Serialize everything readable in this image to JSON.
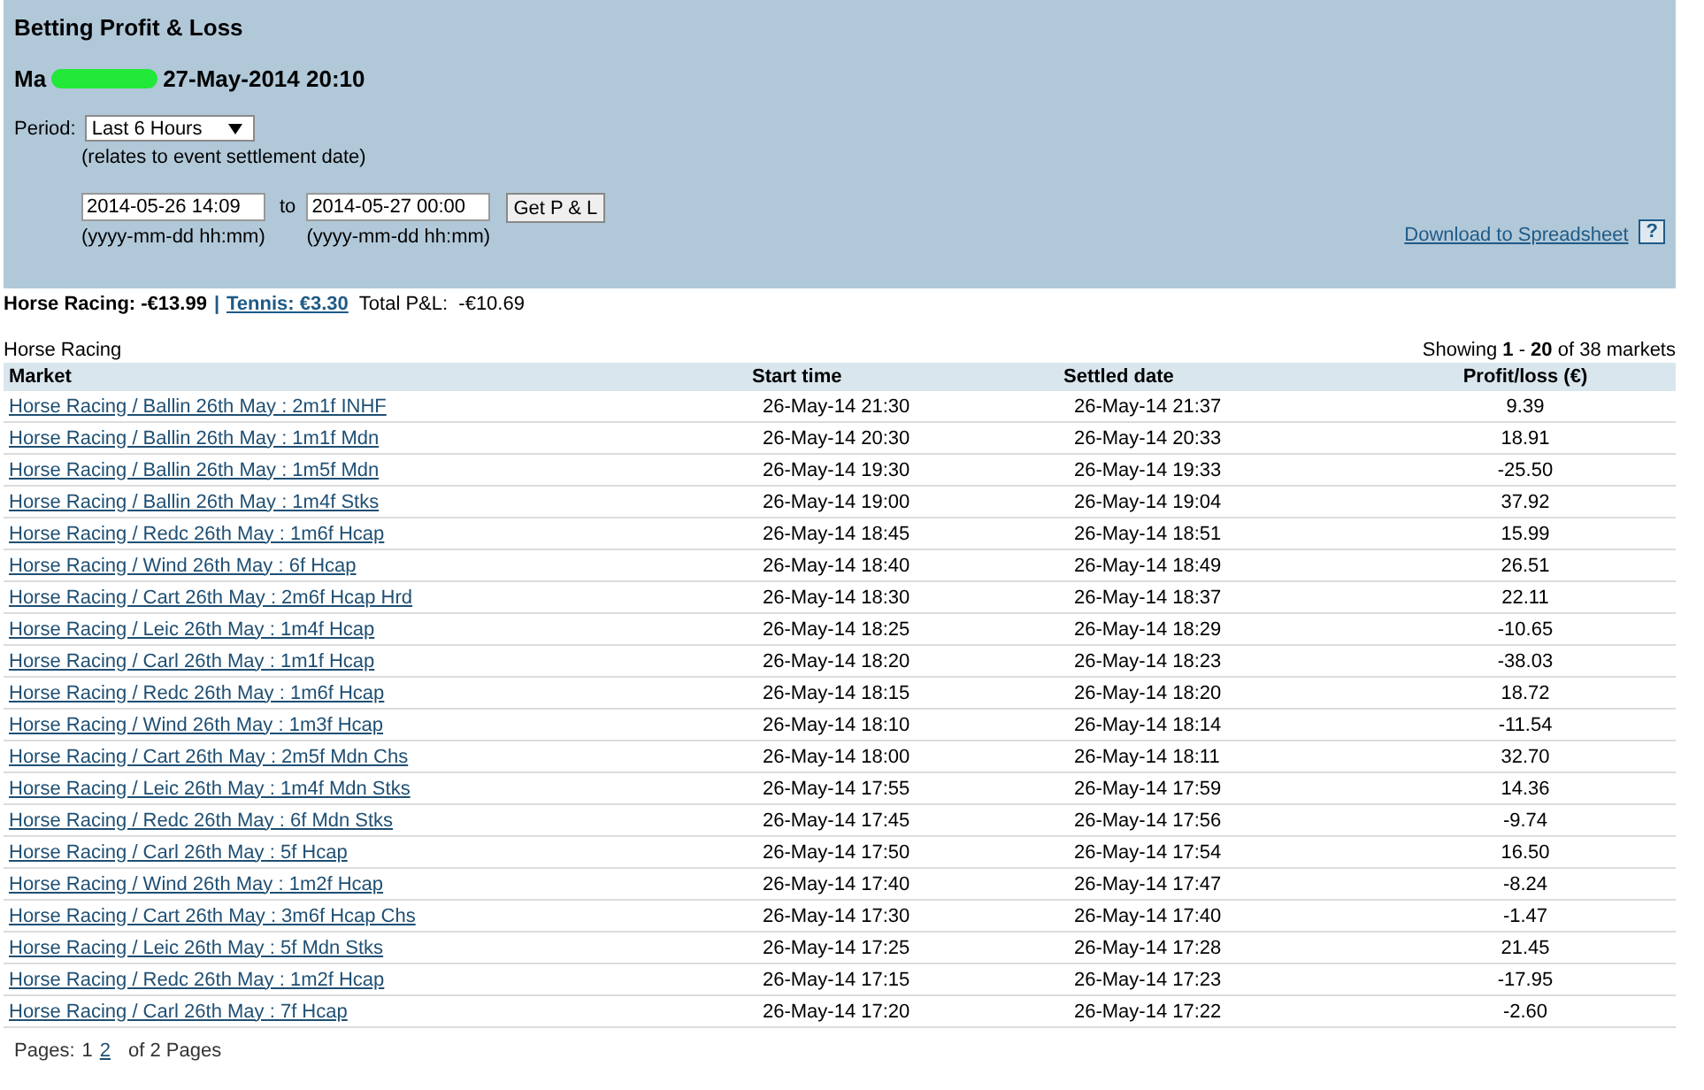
{
  "header": {
    "title": "Betting Profit & Loss",
    "user_prefix": "Ma",
    "redacted": true,
    "timestamp": "27-May-2014 20:10"
  },
  "filter": {
    "period_label": "Period:",
    "period": "Last 6 Hours",
    "period_note": "(relates to event settlement date)",
    "from": "2014-05-26 14:09",
    "to_label": "to",
    "to": "2014-05-27 00:00",
    "from_hint": "(yyyy-mm-dd hh:mm)",
    "to_hint": "(yyyy-mm-dd hh:mm)",
    "button": "Get P & L",
    "download_link": "Download to Spreadsheet",
    "help": "?"
  },
  "summary_separator": "|",
  "summary": [
    {
      "text": "Horse Racing: -€13.99",
      "kind": "current"
    },
    {
      "text": "Tennis: €3.30",
      "kind": "link"
    },
    {
      "text": "Total P&L:  -€10.69",
      "kind": "total"
    }
  ],
  "section": "Horse Racing",
  "showing": "Showing **1** - **20** of 38 markets",
  "table": {
    "columns": [
      "Market",
      "Start time",
      "Settled date",
      "Profit/loss (€)"
    ],
    "rows": [
      [
        "Horse Racing / Ballin 26th May : 2m1f INHF",
        "26-May-14 21:30",
        "26-May-14 21:37",
        "9.39"
      ],
      [
        "Horse Racing / Ballin 26th May : 1m1f Mdn",
        "26-May-14 20:30",
        "26-May-14 20:33",
        "18.91"
      ],
      [
        "Horse Racing / Ballin 26th May : 1m5f Mdn",
        "26-May-14 19:30",
        "26-May-14 19:33",
        "-25.50"
      ],
      [
        "Horse Racing / Ballin 26th May : 1m4f Stks",
        "26-May-14 19:00",
        "26-May-14 19:04",
        "37.92"
      ],
      [
        "Horse Racing / Redc 26th May : 1m6f Hcap",
        "26-May-14 18:45",
        "26-May-14 18:51",
        "15.99"
      ],
      [
        "Horse Racing / Wind 26th May : 6f Hcap",
        "26-May-14 18:40",
        "26-May-14 18:49",
        "26.51"
      ],
      [
        "Horse Racing / Cart 26th May : 2m6f Hcap Hrd",
        "26-May-14 18:30",
        "26-May-14 18:37",
        "22.11"
      ],
      [
        "Horse Racing / Leic 26th May : 1m4f Hcap",
        "26-May-14 18:25",
        "26-May-14 18:29",
        "-10.65"
      ],
      [
        "Horse Racing / Carl 26th May : 1m1f Hcap",
        "26-May-14 18:20",
        "26-May-14 18:23",
        "-38.03"
      ],
      [
        "Horse Racing / Redc 26th May : 1m6f Hcap",
        "26-May-14 18:15",
        "26-May-14 18:20",
        "18.72"
      ],
      [
        "Horse Racing / Wind 26th May : 1m3f Hcap",
        "26-May-14 18:10",
        "26-May-14 18:14",
        "-11.54"
      ],
      [
        "Horse Racing / Cart 26th May : 2m5f Mdn Chs",
        "26-May-14 18:00",
        "26-May-14 18:11",
        "32.70"
      ],
      [
        "Horse Racing / Leic 26th May : 1m4f Mdn Stks",
        "26-May-14 17:55",
        "26-May-14 17:59",
        "14.36"
      ],
      [
        "Horse Racing / Redc 26th May : 6f Mdn Stks",
        "26-May-14 17:45",
        "26-May-14 17:56",
        "-9.74"
      ],
      [
        "Horse Racing / Carl 26th May : 5f Hcap",
        "26-May-14 17:50",
        "26-May-14 17:54",
        "16.50"
      ],
      [
        "Horse Racing / Wind 26th May : 1m2f Hcap",
        "26-May-14 17:40",
        "26-May-14 17:47",
        "-8.24"
      ],
      [
        "Horse Racing / Cart 26th May : 3m6f Hcap Chs",
        "26-May-14 17:30",
        "26-May-14 17:40",
        "-1.47"
      ],
      [
        "Horse Racing / Leic 26th May : 5f Mdn Stks",
        "26-May-14 17:25",
        "26-May-14 17:28",
        "21.45"
      ],
      [
        "Horse Racing / Redc 26th May : 1m2f Hcap",
        "26-May-14 17:15",
        "26-May-14 17:23",
        "-17.95"
      ],
      [
        "Horse Racing / Carl 26th May : 7f Hcap",
        "26-May-14 17:20",
        "26-May-14 17:22",
        "-2.60"
      ]
    ]
  },
  "pager": {
    "label": "Pages:",
    "pages": [
      {
        "text": "1",
        "selected": true
      },
      {
        "text": "2",
        "selected": false
      }
    ],
    "total": "of 2 Pages"
  }
}
